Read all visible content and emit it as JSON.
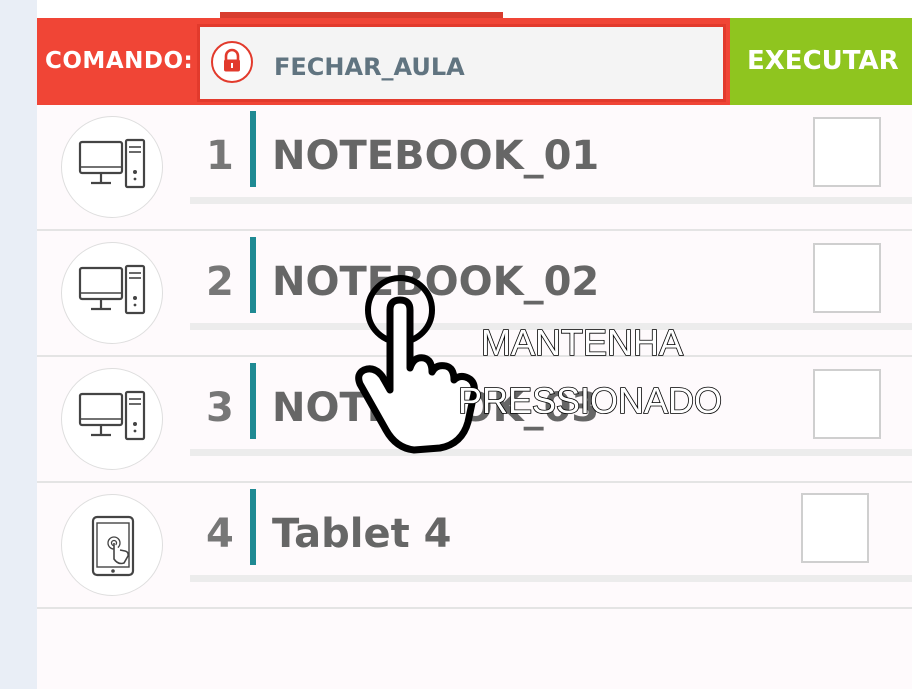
{
  "command": {
    "label": "COMANDO:",
    "value": "FECHAR_AULA",
    "lock_icon": "lock-icon",
    "execute_label": "EXECUTAR"
  },
  "colors": {
    "command_bar": "#f04536",
    "execute": "#8fc51f",
    "accent": "#1f8a93"
  },
  "devices": [
    {
      "number": "1",
      "name": "NOTEBOOK_01",
      "icon": "desktop-computer-icon"
    },
    {
      "number": "2",
      "name": "NOTEBOOK_02",
      "icon": "desktop-computer-icon"
    },
    {
      "number": "3",
      "name": "NOTEBOOK_03",
      "icon": "desktop-computer-icon"
    },
    {
      "number": "4",
      "name": "Tablet 4",
      "icon": "tablet-icon"
    }
  ],
  "overlay": {
    "icon": "hand-pointer-icon",
    "line1": "MANTENHA",
    "line2": "PRESSIONADO"
  }
}
